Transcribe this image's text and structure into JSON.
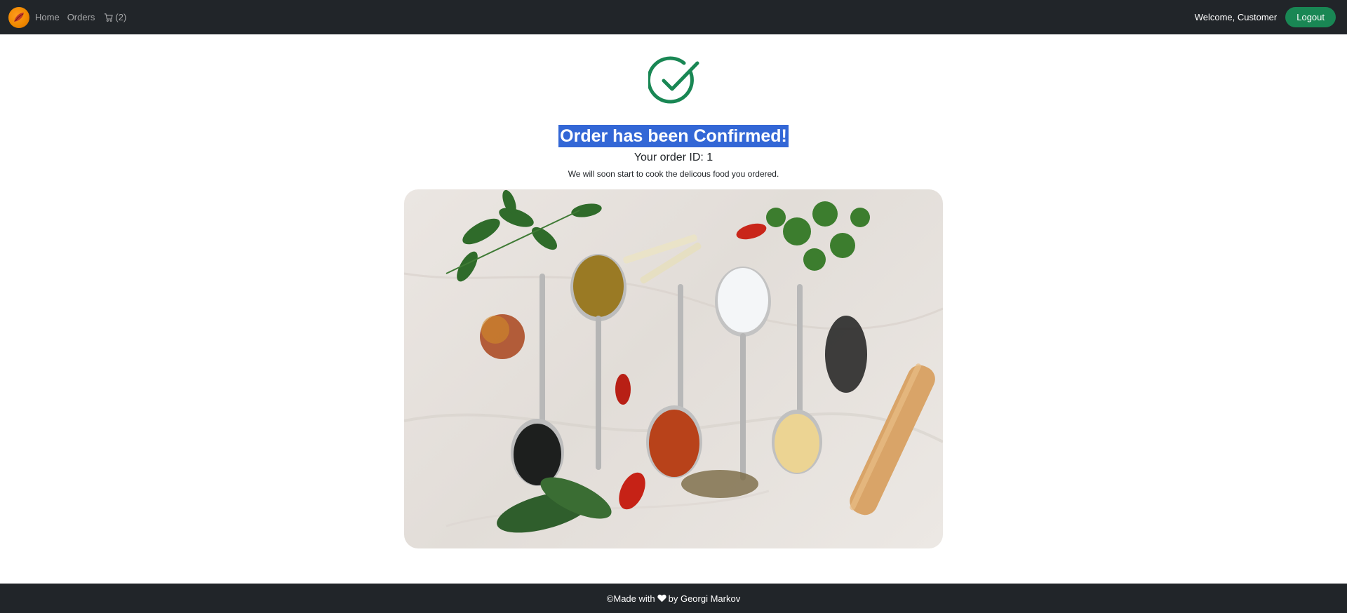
{
  "nav": {
    "links": [
      {
        "label": "Home"
      },
      {
        "label": "Orders"
      }
    ],
    "cart_count": "(2)",
    "welcome": "Welcome, Customer",
    "logout_label": "Logout"
  },
  "confirmation": {
    "title": "Order has been Confirmed!",
    "order_id": "Your order ID: 1",
    "message": "We will soon start to cook the delicous food you ordered."
  },
  "footer": {
    "prefix": "©Made with",
    "suffix": "by Georgi Markov"
  },
  "colors": {
    "navbar_bg": "#212529",
    "success_green": "#198754",
    "selection_blue": "#3367d6"
  },
  "icons": [
    "logo-icon",
    "cart-icon",
    "check-circle-icon",
    "heart-icon"
  ]
}
